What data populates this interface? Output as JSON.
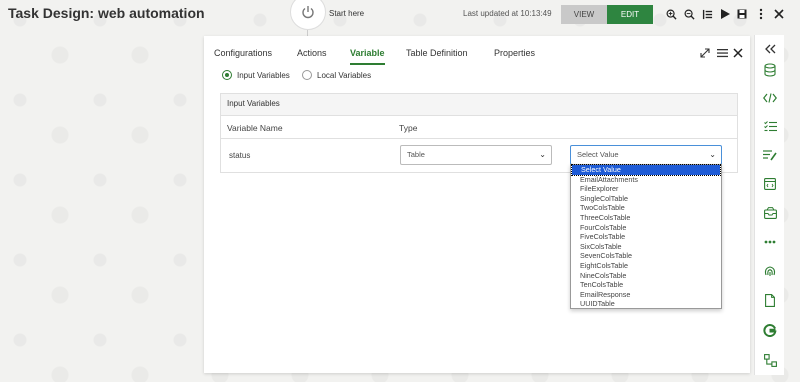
{
  "header": {
    "title": "Task Design: web automation",
    "start_label": "Start here",
    "updated": "Last updated at 10:13:49",
    "view_label": "VIEW",
    "edit_label": "EDIT",
    "tools": [
      "zoom-in-icon",
      "zoom-out-icon",
      "align-icon",
      "play-icon",
      "save-icon",
      "more-vertical-icon",
      "close-icon"
    ]
  },
  "panel": {
    "tabs": [
      "Configurations",
      "Actions",
      "Variable",
      "Table Definition",
      "Properties"
    ],
    "active_tab": "Variable",
    "radios": {
      "input": "Input Variables",
      "local": "Local Variables",
      "selected": "input"
    },
    "section_title": "Input Variables",
    "columns": {
      "name": "Variable Name",
      "type": "Type"
    },
    "row": {
      "name": "status",
      "type": "Table",
      "value": "Select Value"
    },
    "dropdown_options": [
      "Select Value",
      "EmailAttachments",
      "FileExplorer",
      "SingleColTable",
      "TwoColsTable",
      "ThreeColsTable",
      "FourColsTable",
      "FiveColsTable",
      "SixColsTable",
      "SevenColsTable",
      "EightColsTable",
      "NineColsTable",
      "TenColsTable",
      "EmailResponse",
      "UUIDTable"
    ],
    "dropdown_selected": "Select Value"
  },
  "rail": {
    "icons": [
      "collapse-icon",
      "database-icon",
      "code-icon",
      "checklist-icon",
      "edit-list-icon",
      "browser-icon",
      "inbox-icon",
      "more-horizontal-icon",
      "fingerprint-icon",
      "document-icon",
      "google-icon",
      "flow-icon"
    ]
  },
  "colors": {
    "accent_green": "#2e7d32",
    "edit_button": "#2e8540",
    "selection_blue": "#1e5bd6"
  }
}
